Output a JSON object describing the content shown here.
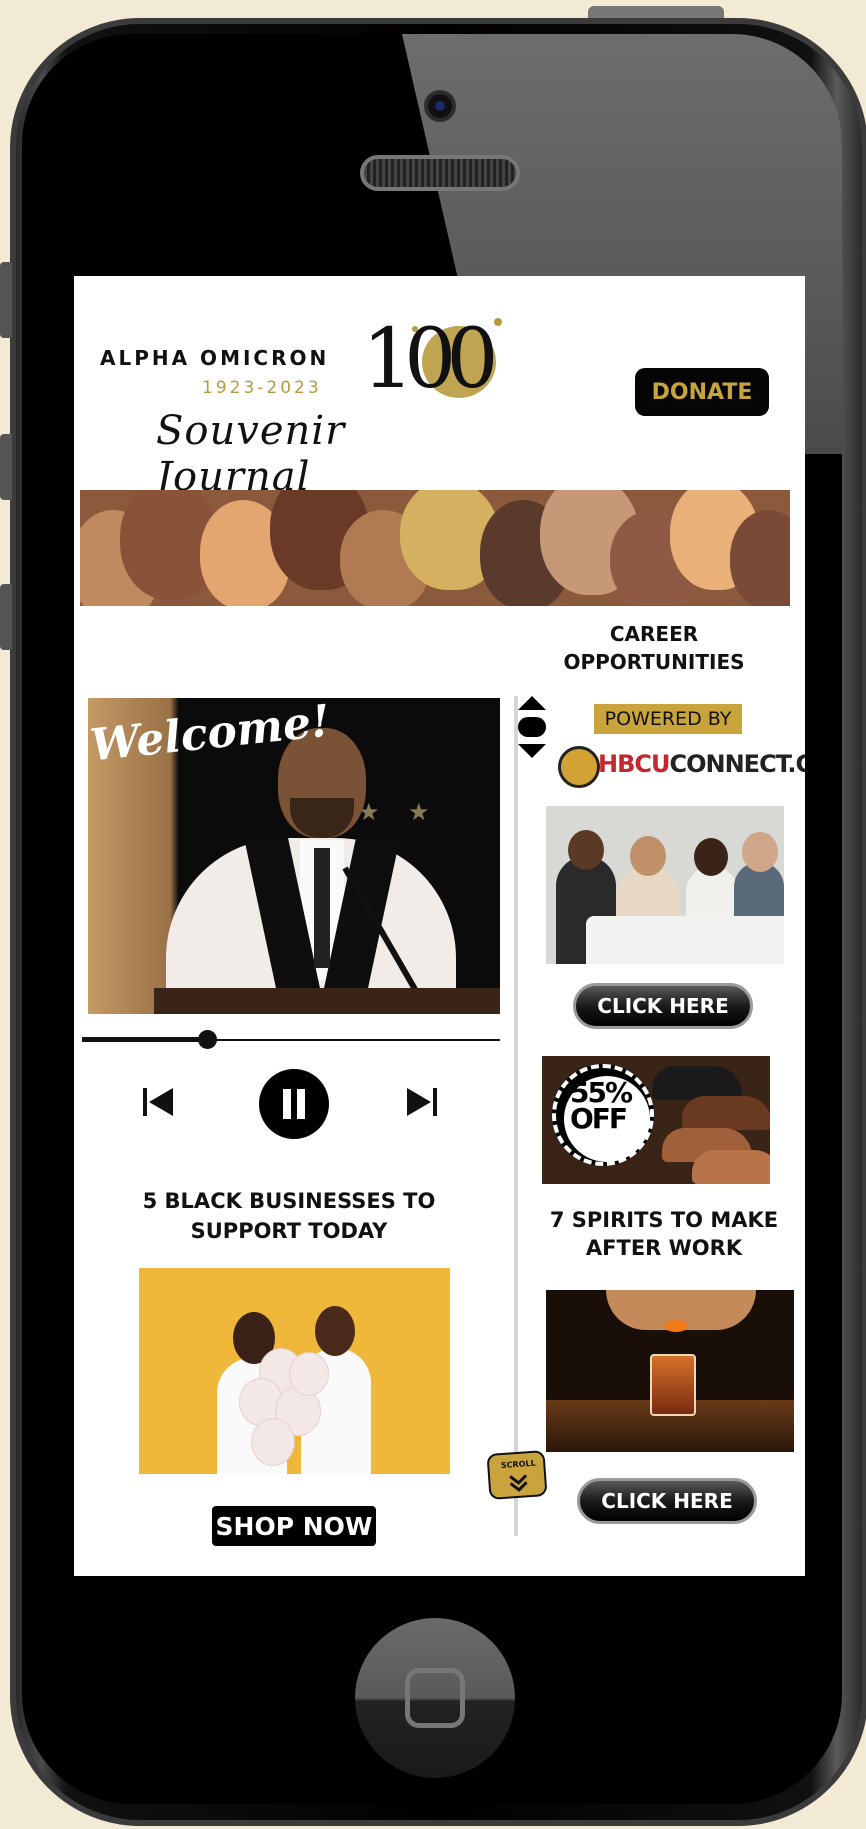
{
  "header": {
    "logo_line1": "ALPHA OMICRON",
    "logo_years": "1923-2023",
    "logo_number": "100",
    "logo_script": "Souvenir Journal",
    "donate_label": "DONATE"
  },
  "sidebar": {
    "career_title": "CAREER OPPORTUNITIES",
    "powered_by": "POWERED BY",
    "partner_logo_prefix": "HBCU",
    "partner_logo_suffix": "CONNECT.COM",
    "click_here_1": "CLICK HERE",
    "sale_badge": "55% OFF",
    "spirits_title": "7 SPIRITS TO MAKE AFTER WORK",
    "click_here_2": "CLICK HERE",
    "scroll_label": "SCROLL"
  },
  "main": {
    "video_overlay": "Welcome!",
    "progress_fraction": 0.3,
    "businesses_title": "5 BLACK BUSINESSES TO SUPPORT TODAY",
    "shop_now_label": "SHOP NOW"
  },
  "icons": {
    "previous": "skip-previous-icon",
    "pause": "pause-icon",
    "next": "skip-next-icon",
    "scroll_up": "triangle-up-icon",
    "scroll_down": "triangle-down-icon",
    "scroll_badge": "chevron-down-icon"
  },
  "colors": {
    "gold": "#c9a43c",
    "black": "#000000",
    "white": "#ffffff"
  }
}
